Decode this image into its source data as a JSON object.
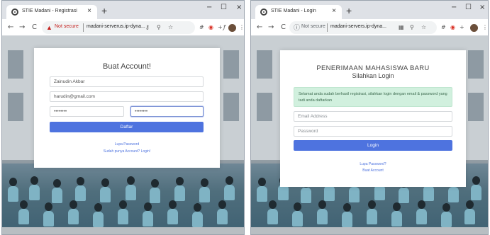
{
  "left": {
    "tab_title": "STIE Madani - Registrasi",
    "tab_close": "×",
    "new_tab": "+",
    "win_min": "−",
    "win_max": "☐",
    "win_close": "×",
    "nav_back": "←",
    "nav_forward": "→",
    "nav_reload": "C",
    "not_secure_label": "Not secure",
    "url": "madani-serverus.ip-dyna...",
    "heading": "Buat Account!",
    "name_value": "Zainudin Akbar",
    "email_value": "harudin@gmail.com",
    "password_value": "••••••••",
    "password_repeat_value": "••••••••",
    "submit_label": "Daftar",
    "forgot_link": "Lupa Password",
    "login_link": "Sudah punya Account? Login!"
  },
  "right": {
    "tab_title": "STIE Madani - Login",
    "tab_close": "×",
    "new_tab": "+",
    "win_min": "−",
    "win_max": "☐",
    "win_close": "×",
    "nav_back": "←",
    "nav_forward": "→",
    "nav_reload": "C",
    "not_secure_label": "Not secure",
    "url": "madani-servers.ip-dyna...",
    "heading": "PENERIMAAN MAHASISWA BARU",
    "subheading": "Silahkan Login",
    "alert": "Selamat anda sudah berhasil registrasi, silahkan login dengan email & password yang tadi anda daftarkan",
    "email_placeholder": "Email Address",
    "password_placeholder": "Password",
    "submit_label": "Login",
    "forgot_link": "Lupa Password?",
    "register_link": "Buat Account"
  },
  "colors": {
    "primary": "#4e73df",
    "alert_bg": "#d1f0de",
    "not_secure": "#c5221f"
  },
  "icons": {
    "favicon": "site-favicon-icon",
    "key": "key-icon",
    "zoom": "zoom-icon",
    "star": "star-icon",
    "extensions": "extensions-icon",
    "menu": "menu-dots-icon"
  }
}
